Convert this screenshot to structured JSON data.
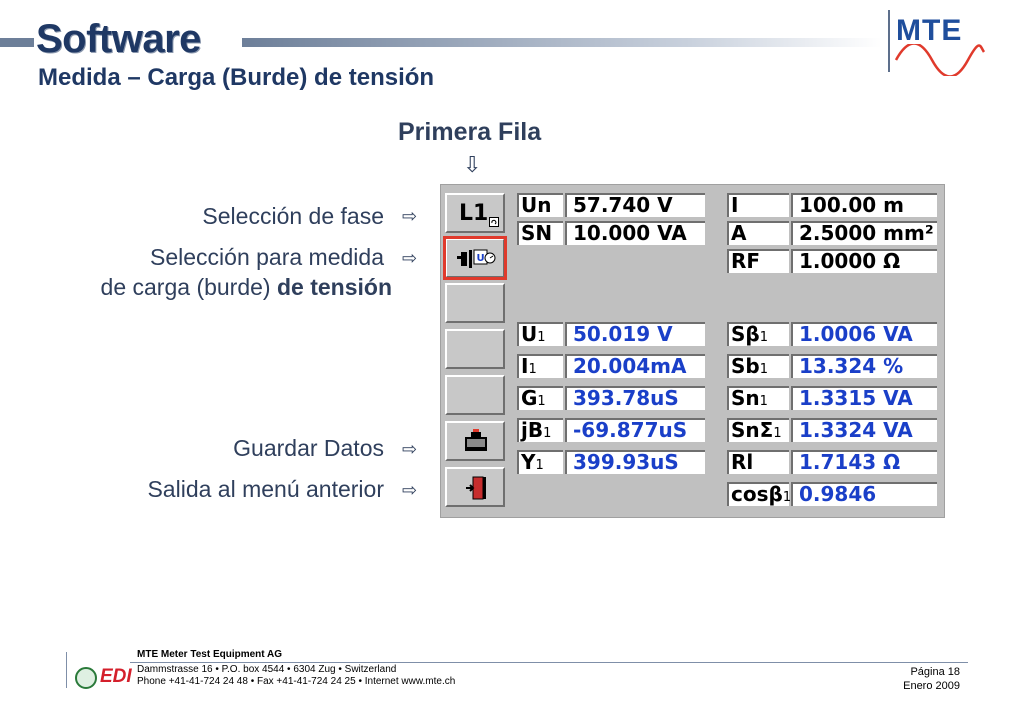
{
  "header": {
    "title": "Software",
    "subtitle": "Medida – Carga (Burde) de tensión",
    "logo_text": "MTE"
  },
  "annotations": {
    "column_title": "Primera Fila",
    "down_arrow": "⇩",
    "phase_selection": "Selección de fase",
    "measure_selection_line1": "Selección para medida",
    "measure_selection_line2_a": "de carga (burde) ",
    "measure_selection_line2_b": "de tensión",
    "save_data": "Guardar Datos",
    "exit_menu": "Salida al menú anterior",
    "right_arrow": "⇨"
  },
  "panel": {
    "phase_button_label": "L1",
    "rows_top": [
      {
        "l1": "Un",
        "v1": "57.740  V",
        "l2": "I",
        "v2": "100.00  m"
      },
      {
        "l1": "SN",
        "v1": "10.000  VA",
        "l2": "A",
        "v2": "2.5000  mm²"
      },
      {
        "l1": "",
        "v1": "",
        "l2": "RF",
        "v2": "1.0000  Ω"
      }
    ],
    "rows_bottom": [
      {
        "l1": "U",
        "s1": "1",
        "v1": "50.019  V",
        "l2": "Sβ",
        "s2": "1",
        "v2": "1.0006  VA"
      },
      {
        "l1": "I",
        "s1": "1",
        "v1": "20.004mA",
        "l2": "Sb",
        "s2": "1",
        "v2": "13.324  %"
      },
      {
        "l1": "G",
        "s1": "1",
        "v1": "393.78uS",
        "l2": "Sn",
        "s2": "1",
        "v2": "1.3315  VA"
      },
      {
        "l1": "jB",
        "s1": "1",
        "v1": "-69.877uS",
        "l2": "SnΣ",
        "s2": "1",
        "v2": "1.3324  VA"
      },
      {
        "l1": "Y",
        "s1": "1",
        "v1": "399.93uS",
        "l2": "Rl",
        "s2": "",
        "v2": "1.7143  Ω"
      },
      {
        "l1": "",
        "s1": "",
        "v1": "",
        "l2": "cosβ",
        "s2": "1",
        "v2": "0.9846"
      }
    ]
  },
  "footer": {
    "company": "MTE Meter Test Equipment AG",
    "address": "Dammstrasse 16 • P.O. box 4544 • 6304 Zug • Switzerland",
    "phone": "Phone +41-41-724 24 48 • Fax +41-41-724 24 25 • Internet www.mte.ch",
    "page": "Página 18",
    "date": "Enero 2009",
    "edi_text": "EDI"
  },
  "colors": {
    "accent_blue": "#1a3fc8",
    "title_navy": "#1f3864",
    "selection_red": "#e03a2c",
    "panel_gray": "#c0c0c0"
  }
}
